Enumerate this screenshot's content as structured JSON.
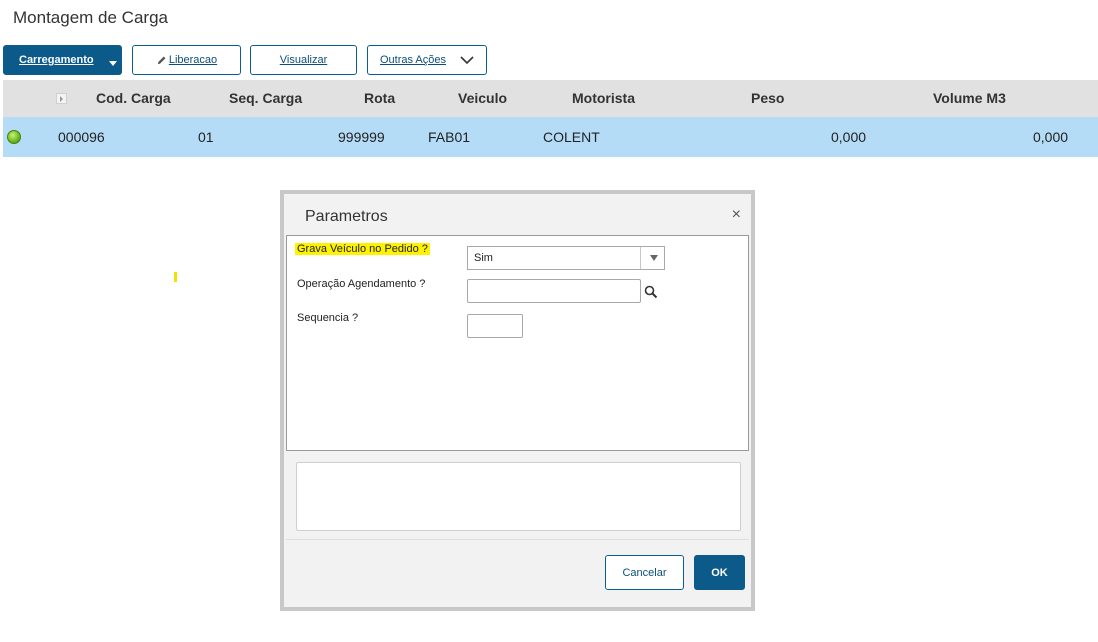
{
  "page": {
    "title": "Montagem de Carga"
  },
  "toolbar": {
    "carregamento": "Carregamento",
    "liberacao": "Liberacao",
    "visualizar": "Visualizar",
    "outras_acoes": "Outras Ações"
  },
  "grid": {
    "columns": [
      "Cod. Carga",
      "Seq. Carga",
      "Rota",
      "Veiculo",
      "Motorista",
      "Peso",
      "Volume M3"
    ],
    "rows": [
      {
        "status": "green",
        "cod_carga": "000096",
        "seq_carga": "01",
        "rota": "999999",
        "veiculo": "FAB01",
        "motorista": "COLENT",
        "peso": "0,000",
        "volume_m3": "0,000"
      }
    ]
  },
  "dialog": {
    "title": "Parametros",
    "close": "×",
    "fields": {
      "grava_label": "Grava Veículo no Pedido ?",
      "grava_value": "Sim",
      "operacao_label": "Operação Agendamento ?",
      "operacao_value": "",
      "sequencia_label": "Sequencia ?",
      "sequencia_value": ""
    },
    "buttons": {
      "cancel": "Cancelar",
      "ok": "OK"
    }
  },
  "colors": {
    "primary": "#0b5a8a",
    "row_selected": "#b5dcf6",
    "header_bg": "#e1e1e1",
    "highlight": "#fff200",
    "status_green": "#6fbf1f"
  },
  "icons": [
    "pencil-icon",
    "chevron-down-icon",
    "search-icon",
    "close-icon",
    "expand-icon",
    "status-green-icon"
  ]
}
